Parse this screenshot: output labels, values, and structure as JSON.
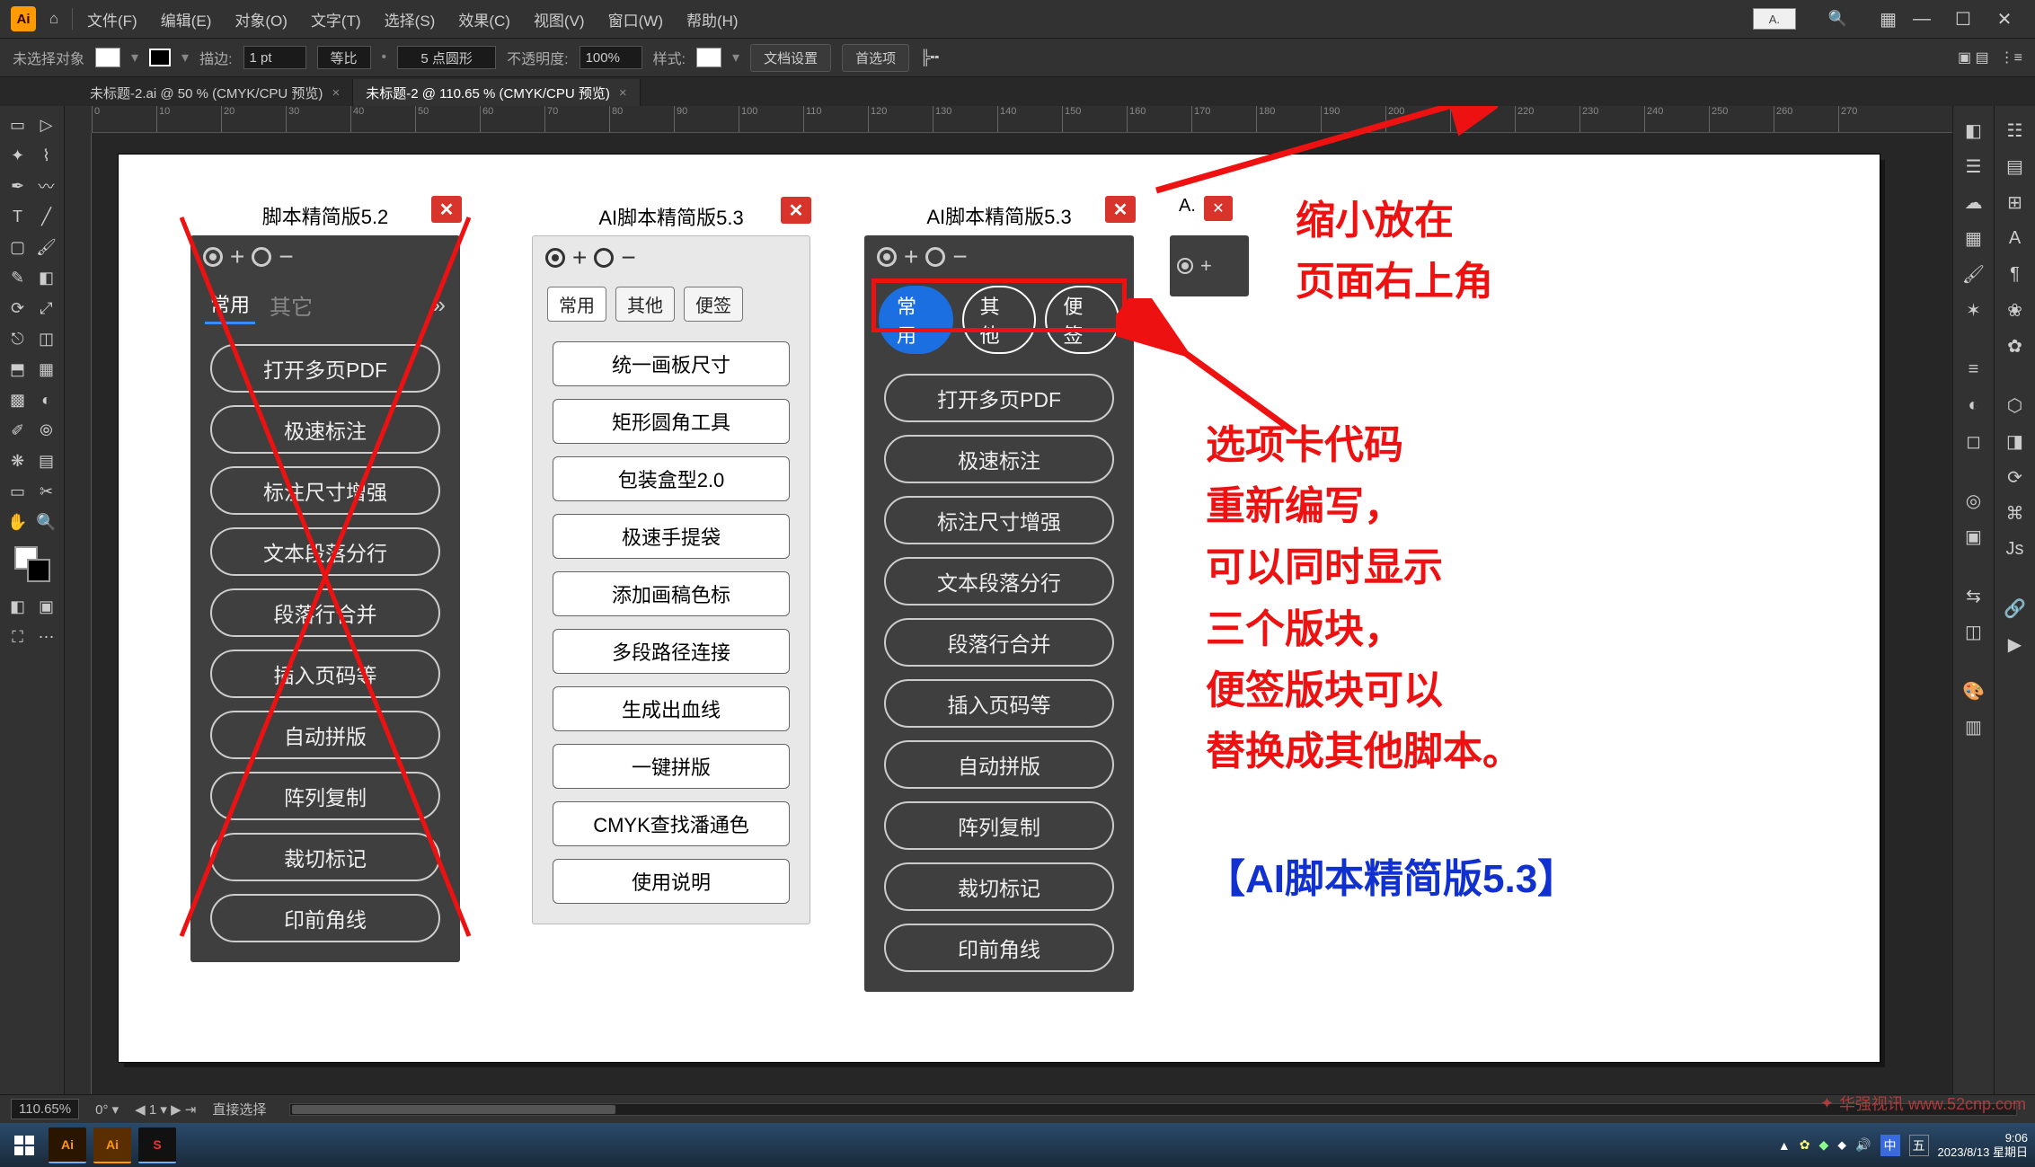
{
  "menubar": {
    "items": [
      "文件(F)",
      "编辑(E)",
      "对象(O)",
      "文字(T)",
      "选择(S)",
      "效果(C)",
      "视图(V)",
      "窗口(W)",
      "帮助(H)"
    ],
    "small_box": "A."
  },
  "controlbar": {
    "no_sel": "未选择对象",
    "stroke_label": "描边:",
    "stroke_val": "1 pt",
    "uniform": "等比",
    "point_shape": "5 点圆形",
    "opacity_label": "不透明度:",
    "opacity_val": "100%",
    "style_label": "样式:",
    "doc_setup": "文档设置",
    "prefs": "首选项"
  },
  "tabs": [
    {
      "label": "未标题-2.ai @ 50 % (CMYK/CPU 预览)",
      "active": false
    },
    {
      "label": "未标题-2 @ 110.65 % (CMYK/CPU 预览)",
      "active": true
    }
  ],
  "ruler_numbers": [
    "0",
    "10",
    "20",
    "30",
    "40",
    "50",
    "60",
    "70",
    "80",
    "90",
    "100",
    "110",
    "120",
    "130",
    "140",
    "150",
    "160",
    "170",
    "180",
    "190",
    "200",
    "210",
    "220",
    "230",
    "240",
    "250",
    "260",
    "270"
  ],
  "panel52": {
    "title": "脚本精简版5.2",
    "tabs": [
      "常用",
      "其它"
    ],
    "buttons": [
      "打开多页PDF",
      "极速标注",
      "标注尺寸增强",
      "文本段落分行",
      "段落行合并",
      "插入页码等",
      "自动拼版",
      "阵列复制",
      "裁切标记",
      "印前角线"
    ]
  },
  "panel53light": {
    "title": "AI脚本精简版5.3",
    "tabs": [
      "常用",
      "其他",
      "便签"
    ],
    "buttons": [
      "统一画板尺寸",
      "矩形圆角工具",
      "包装盒型2.0",
      "极速手提袋",
      "添加画稿色标",
      "多段路径连接",
      "生成出血线",
      "一键拼版",
      "CMYK查找潘通色",
      "使用说明"
    ]
  },
  "panel53dark": {
    "title": "AI脚本精简版5.3",
    "tabs": [
      "常用",
      "其他",
      "便签"
    ],
    "buttons": [
      "打开多页PDF",
      "极速标注",
      "标注尺寸增强",
      "文本段落分行",
      "段落行合并",
      "插入页码等",
      "自动拼版",
      "阵列复制",
      "裁切标记",
      "印前角线"
    ]
  },
  "mini_panel": {
    "title": "A."
  },
  "annotations": {
    "top": "缩小放在\n页面右上角",
    "mid": "选项卡代码\n重新编写，\n可以同时显示\n三个版块，\n便签版块可以\n替换成其他脚本。",
    "bottom": "【AI脚本精简版5.3】"
  },
  "status": {
    "zoom": "110.65%",
    "art_idx": "1",
    "tool": "直接选择"
  },
  "taskbar": {
    "clock_time": "9:06",
    "clock_date": "2023/8/13 星期日",
    "ime": "中"
  },
  "watermark": "华强视讯 www.52cnp.com"
}
